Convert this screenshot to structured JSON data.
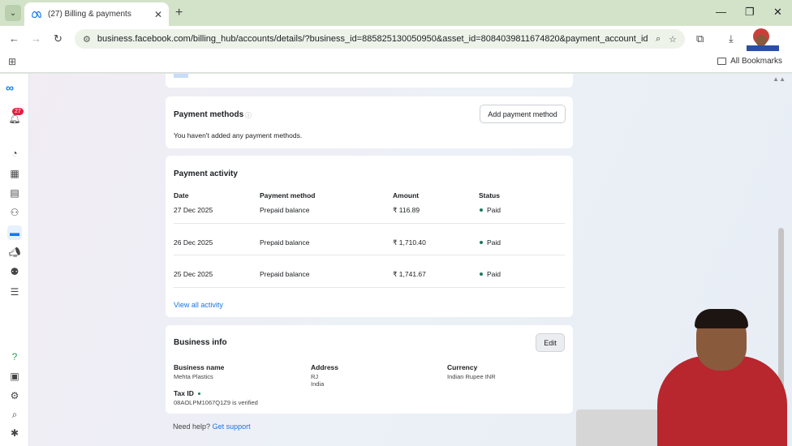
{
  "browser": {
    "tab_title": "(27) Billing & payments",
    "url": "business.facebook.com/billing_hub/accounts/details/?business_id=885825130050950&asset_id=8084039811674820&payment_account_id...",
    "all_bookmarks": "All Bookmarks"
  },
  "nav": {
    "notification_count": "27"
  },
  "payment_methods": {
    "title": "Payment methods",
    "add_button": "Add payment method",
    "empty_text": "You haven't added any payment methods."
  },
  "payment_activity": {
    "title": "Payment activity",
    "columns": [
      "Date",
      "Payment method",
      "Amount",
      "Status"
    ],
    "rows": [
      {
        "date": "27 Dec 2025",
        "method": "Prepaid balance",
        "amount": "₹ 116.89",
        "status": "Paid"
      },
      {
        "date": "26 Dec 2025",
        "method": "Prepaid balance",
        "amount": "₹ 1,710.40",
        "status": "Paid"
      },
      {
        "date": "25 Dec 2025",
        "method": "Prepaid balance",
        "amount": "₹ 1,741.67",
        "status": "Paid"
      }
    ],
    "view_all": "View all activity"
  },
  "business_info": {
    "title": "Business info",
    "edit_button": "Edit",
    "business_name_label": "Business name",
    "business_name": "Mehta Plastics",
    "address_label": "Address",
    "address_line1": "RJ",
    "address_line2": "India",
    "currency_label": "Currency",
    "currency": "Indian Rupee INR",
    "tax_id_label": "Tax ID",
    "tax_id_value": "08AOLPM1067Q1Z9 is verified"
  },
  "help": {
    "text": "Need help?",
    "link": "Get support"
  },
  "colors": {
    "accent": "#1b74e4",
    "paid": "#1d7a5f",
    "chrome": "#d3e3c9"
  }
}
